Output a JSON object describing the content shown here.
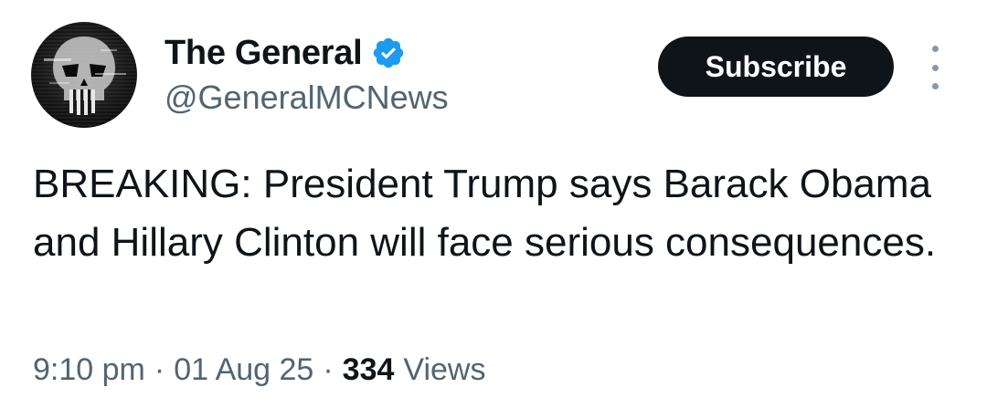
{
  "author": {
    "display_name": "The General",
    "handle": "@GeneralMCNews",
    "verified": true,
    "avatar_icon": "skull-avatar-icon",
    "verified_icon": "verified-badge-icon"
  },
  "actions": {
    "subscribe_label": "Subscribe",
    "more_icon": "more-vertical-icon"
  },
  "tweet": {
    "text": "BREAKING: President Trump says Barack Obama and Hillary Clinton will face serious consequences."
  },
  "meta": {
    "time": "9:10 pm",
    "date": "01 Aug 25",
    "separator": "·",
    "views_count": "334",
    "views_label": "Views"
  },
  "colors": {
    "text_primary": "#0f1419",
    "text_secondary": "#536471",
    "verified_blue": "#1d9bf0",
    "button_bg": "#0f1419",
    "button_text": "#ffffff"
  }
}
